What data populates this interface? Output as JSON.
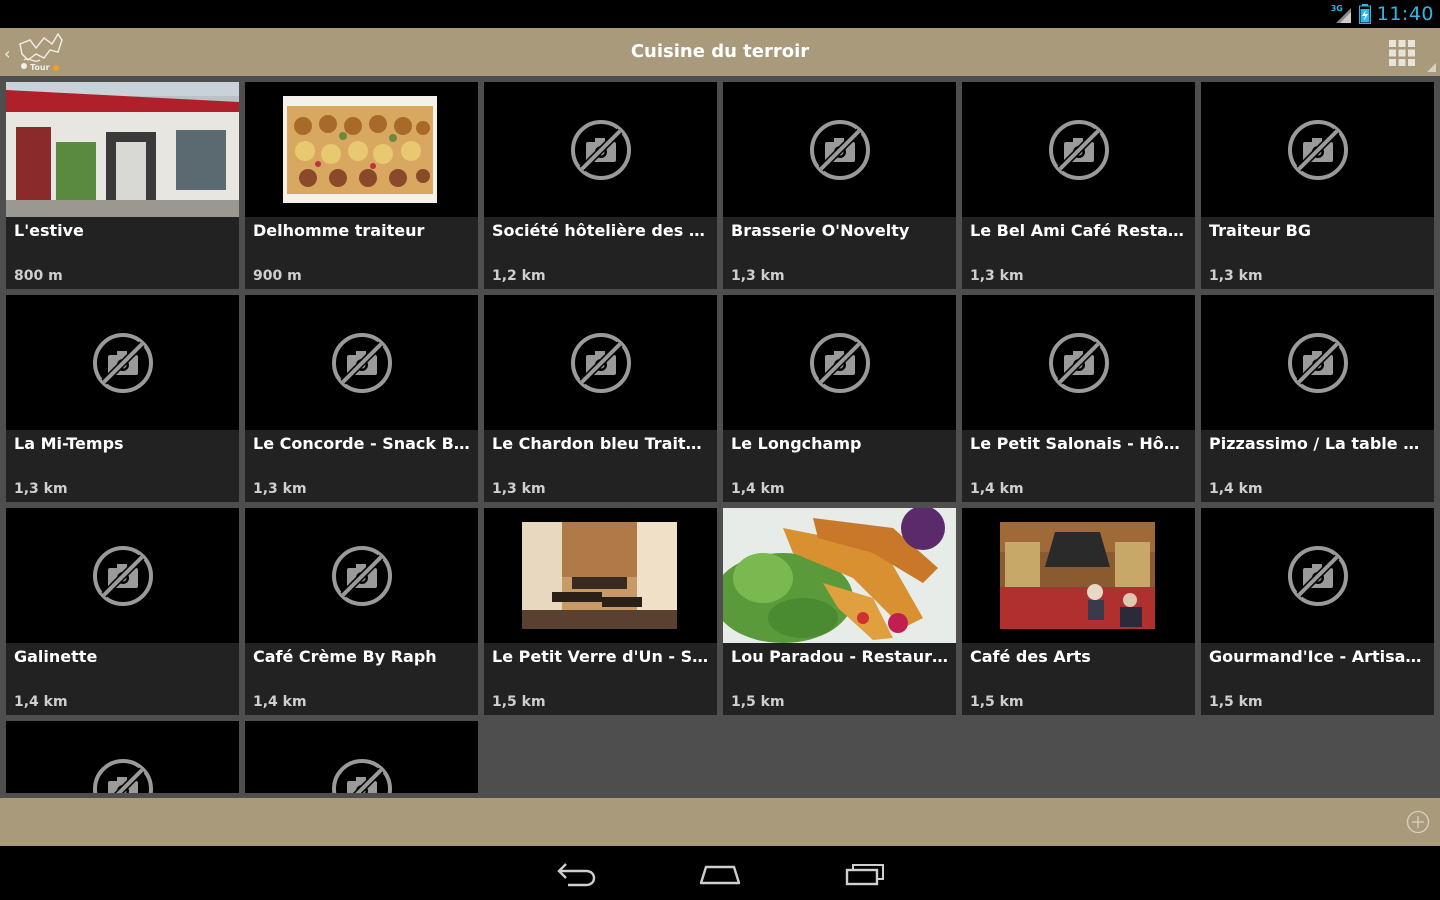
{
  "status": {
    "network": "3G",
    "time": "11:40"
  },
  "actionbar": {
    "title": "Cuisine du terroir"
  },
  "colors": {
    "bar": "#a99a7c",
    "content_bg": "#4e4e4e",
    "card_bg": "#222222",
    "accent": "#33b5e5"
  },
  "icons": {
    "back": "back-chevron-icon",
    "logo": "app-logo-icon",
    "grid": "grid-view-icon",
    "no_image": "no-image-icon",
    "add": "add-circle-icon",
    "nav_back": "nav-back-icon",
    "nav_home": "nav-home-icon",
    "nav_recents": "nav-recents-icon"
  },
  "places": [
    {
      "name": "L'estive",
      "distance": "800 m"
    },
    {
      "name": "Delhomme traiteur",
      "distance": "900 m"
    },
    {
      "name": "Société hôtelière des vian...",
      "distance": "1,2 km"
    },
    {
      "name": "Brasserie O'Novelty",
      "distance": "1,3 km"
    },
    {
      "name": "Le Bel Ami Café Restaurant",
      "distance": "1,3 km"
    },
    {
      "name": "Traiteur BG",
      "distance": "1,3 km"
    },
    {
      "name": "La Mi-Temps",
      "distance": "1,3 km"
    },
    {
      "name": "Le Concorde - Snack Bar",
      "distance": "1,3 km"
    },
    {
      "name": "Le Chardon bleu Traiteur",
      "distance": "1,3 km"
    },
    {
      "name": "Le Longchamp",
      "distance": "1,4 km"
    },
    {
      "name": "Le Petit Salonais - Hôtel-...",
      "distance": "1,4 km"
    },
    {
      "name": "Pizzassimo / La table d'O...",
      "distance": "1,4 km"
    },
    {
      "name": "Galinette",
      "distance": "1,4 km"
    },
    {
      "name": "Café Crème By Raph",
      "distance": "1,4 km"
    },
    {
      "name": "Le Petit Verre d'Un - Spéc...",
      "distance": "1,5 km"
    },
    {
      "name": "Lou Paradou - Restaurant...",
      "distance": "1,5 km"
    },
    {
      "name": "Café des Arts",
      "distance": "1,5 km"
    },
    {
      "name": "Gourmand'Ice - Artisan Gl...",
      "distance": "1,5 km"
    }
  ]
}
